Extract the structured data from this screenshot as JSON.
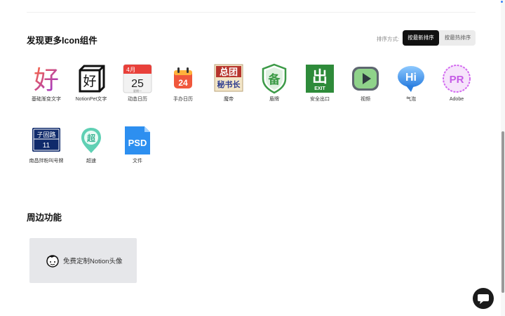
{
  "section_more": {
    "title": "发现更多Icon组件",
    "sort_label": "排序方式:",
    "sort_newest": "按最新排序",
    "sort_popular": "按最热排序",
    "icons": [
      {
        "name": "gradient-char-icon",
        "label": "基础渐变文字",
        "glyph": "好"
      },
      {
        "name": "notionpet-char-icon",
        "label": "NotionPet文字",
        "glyph": "好"
      },
      {
        "name": "calendar-icon",
        "label": "动态日历",
        "month": "4月",
        "day": "25",
        "weekday": "星期一"
      },
      {
        "name": "todo-calendar-icon",
        "label": "手办日历",
        "day": "24"
      },
      {
        "name": "title-plaque-icon",
        "label": "魔帝",
        "line1": "总团",
        "line2": "秘书长"
      },
      {
        "name": "shield-badge-icon",
        "label": "盾牌",
        "glyph": "备"
      },
      {
        "name": "exit-sign-icon",
        "label": "安全出口",
        "glyph": "出",
        "sub": "EXIT"
      },
      {
        "name": "video-play-icon",
        "label": "视频"
      },
      {
        "name": "bubble-icon",
        "label": "气泡",
        "glyph": "Hi"
      },
      {
        "name": "adobe-pr-icon",
        "label": "Adobe",
        "glyph": "PR"
      },
      {
        "name": "street-sign-icon",
        "label": "南昌拌粉叫号牌",
        "line1": "子固路",
        "line2": "11"
      },
      {
        "name": "super-speed-icon",
        "label": "超速",
        "glyph": "超"
      },
      {
        "name": "psd-file-icon",
        "label": "文件",
        "glyph": "PSD"
      }
    ]
  },
  "section_nearby": {
    "title": "周边功能",
    "card_label": "免费定制Notion头像"
  },
  "colors": {
    "sort_active_bg": "#111111",
    "promo_bg": "#e6e7ea",
    "exit_green": "#2e8b3a",
    "psd_blue": "#2d8ff0",
    "calendar_red": "#e8403a"
  }
}
